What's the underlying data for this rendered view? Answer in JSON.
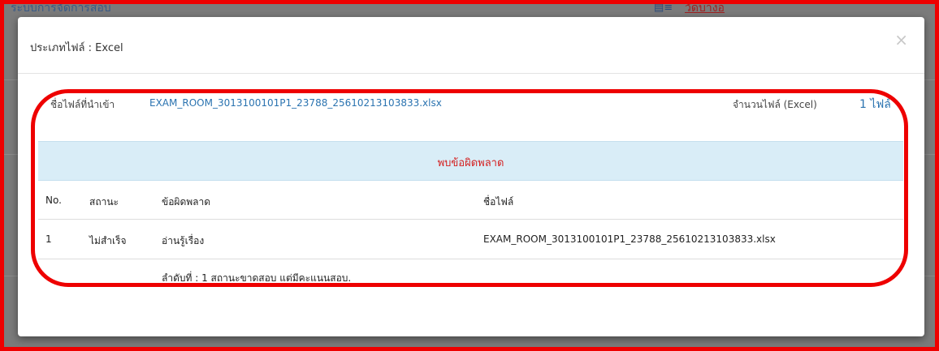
{
  "background": {
    "title": "ระบบการจัดการสอบ",
    "user_icon": "user-card-icon",
    "user_name": "วัดบ่าง่อ"
  },
  "modal": {
    "title": "ประเภทไฟล์ : Excel",
    "close_symbol": "×",
    "file_label": "ชื่อไฟล์ที่นำเข้า",
    "file_name": "EXAM_ROOM_3013100101P1_23788_25610213103833.xlsx",
    "count_label": "จำนวนไฟล์ (Excel)",
    "count_value": "1 ไฟล์",
    "error_banner": "พบข้อผิดพลาด",
    "table": {
      "headers": {
        "no": "No.",
        "status": "สถานะ",
        "error": "ข้อผิดพลาด",
        "file": "ชื่อไฟล์"
      },
      "rows": [
        {
          "no": "1",
          "status": "ไม่สำเร็จ",
          "error": "อ่านรู้เรื่อง",
          "file": "EXAM_ROOM_3013100101P1_23788_25610213103833.xlsx"
        }
      ],
      "detail": "ลำดับที่ : 1 สถานะขาดสอบ แต่มีคะแนนสอบ."
    }
  },
  "colors": {
    "annotation": "#ee0000",
    "link": "#2a73b0",
    "error_text": "#d42020",
    "banner_bg": "#d9edf7"
  }
}
